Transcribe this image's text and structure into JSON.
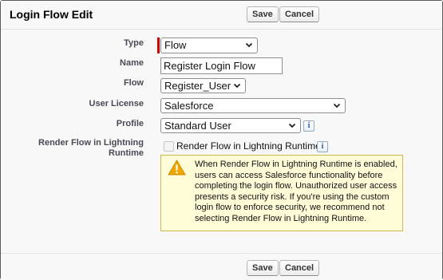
{
  "header": {
    "title": "Login Flow Edit",
    "save_label": "Save",
    "cancel_label": "Cancel"
  },
  "form": {
    "type": {
      "label": "Type",
      "value": "Flow"
    },
    "name": {
      "label": "Name",
      "value": "Register Login Flow"
    },
    "flow": {
      "label": "Flow",
      "value": "Register_User"
    },
    "user_license": {
      "label": "User License",
      "value": "Salesforce"
    },
    "profile": {
      "label": "Profile",
      "value": "Standard User",
      "info_icon": "i"
    },
    "render_flow": {
      "label": "Render Flow in Lightning Runtime",
      "checkbox_label": "Render Flow in Lightning Runtime",
      "checked": false,
      "info_icon": "i"
    }
  },
  "warning": {
    "icon": "warning-triangle-icon",
    "text": "When Render Flow in Lightning Runtime is enabled, users can access Salesforce functionality before completing the login flow. Unauthorized user access presents a security risk. If you're using the custom login flow to enforce security, we recommend not selecting Render Flow in Lightning Runtime."
  },
  "footer": {
    "save_label": "Save",
    "cancel_label": "Cancel"
  },
  "colors": {
    "required": "#cc0000",
    "warning_bg": "#fffcd8",
    "warning_border": "#d6b74a"
  }
}
